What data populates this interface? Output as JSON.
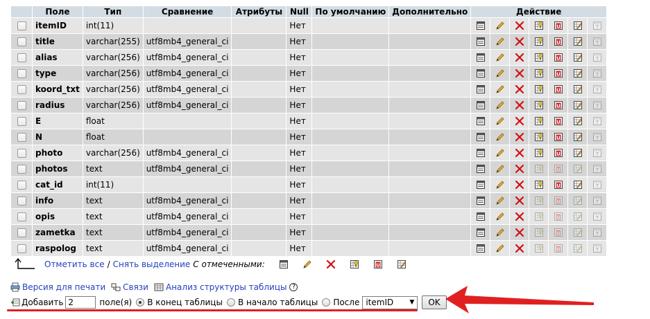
{
  "headers": {
    "field": "Поле",
    "type": "Тип",
    "collation": "Сравнение",
    "attributes": "Атрибуты",
    "null": "Null",
    "default": "По умолчанию",
    "extra": "Дополнительно",
    "action": "Действие"
  },
  "rows": [
    {
      "name": "itemID",
      "type": "int(11)",
      "collation": "",
      "null": "Нет",
      "dim": false
    },
    {
      "name": "title",
      "type": "varchar(255)",
      "collation": "utf8mb4_general_ci",
      "null": "Нет",
      "dim": false
    },
    {
      "name": "alias",
      "type": "varchar(256)",
      "collation": "utf8mb4_general_ci",
      "null": "Нет",
      "dim": false
    },
    {
      "name": "type",
      "type": "varchar(256)",
      "collation": "utf8mb4_general_ci",
      "null": "Нет",
      "dim": false
    },
    {
      "name": "koord_txt",
      "type": "varchar(256)",
      "collation": "utf8mb4_general_ci",
      "null": "Нет",
      "dim": false
    },
    {
      "name": "radius",
      "type": "varchar(256)",
      "collation": "utf8mb4_general_ci",
      "null": "Нет",
      "dim": false
    },
    {
      "name": "E",
      "type": "float",
      "collation": "",
      "null": "Нет",
      "dim": false
    },
    {
      "name": "N",
      "type": "float",
      "collation": "",
      "null": "Нет",
      "dim": false
    },
    {
      "name": "photo",
      "type": "varchar(256)",
      "collation": "utf8mb4_general_ci",
      "null": "Нет",
      "dim": false
    },
    {
      "name": "photos",
      "type": "text",
      "collation": "utf8mb4_general_ci",
      "null": "Нет",
      "dim": true
    },
    {
      "name": "cat_id",
      "type": "int(11)",
      "collation": "",
      "null": "Нет",
      "dim": false
    },
    {
      "name": "info",
      "type": "text",
      "collation": "utf8mb4_general_ci",
      "null": "Нет",
      "dim": true
    },
    {
      "name": "opis",
      "type": "text",
      "collation": "utf8mb4_general_ci",
      "null": "Нет",
      "dim": true
    },
    {
      "name": "zametka",
      "type": "text",
      "collation": "utf8mb4_general_ci",
      "null": "Нет",
      "dim": true
    },
    {
      "name": "raspolog",
      "type": "text",
      "collation": "utf8mb4_general_ci",
      "null": "Нет",
      "dim": true
    }
  ],
  "selection": {
    "check_all": "Отметить все",
    "separator": "/",
    "uncheck_all": "Снять выделение",
    "with_selected": "С отмеченными:"
  },
  "links": {
    "print": "Версия для печати",
    "relations": "Связи",
    "analyze": "Анализ структуры таблицы"
  },
  "add_fields": {
    "label": "Добавить",
    "count": "2",
    "fields_label": "поле(я)",
    "at_end": "В конец таблицы",
    "at_begin": "В начало таблицы",
    "after": "После",
    "after_field": "itemID",
    "ok": "OK"
  },
  "colors": {
    "header_bg": "#d3dce3",
    "row_odd": "#e5e5e5",
    "row_even": "#d5d5d5",
    "link": "#2340c0",
    "annotation": "#e02020"
  }
}
